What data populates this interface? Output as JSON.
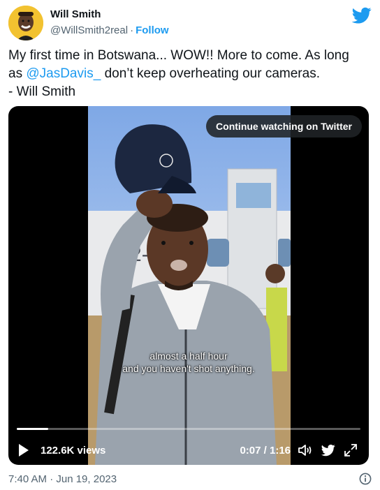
{
  "author": {
    "name": "Will Smith",
    "handle": "@WillSmith2real",
    "separator": "·",
    "follow_label": "Follow"
  },
  "tweet": {
    "line1": "My first time in Botswana... WOW!! More to come. As long",
    "line2_prefix": "as ",
    "mention": "@JasDavis_",
    "line2_suffix": " don’t keep overheating our cameras.",
    "line3": "- Will Smith"
  },
  "video": {
    "continue_label": "Continue watching on Twitter",
    "caption_line1": "almost a half hour",
    "caption_line2": "and you haven't shot anything.",
    "views": "122.6K views",
    "time": "0:07 / 1:16",
    "progress": 0.092
  },
  "footer": {
    "timestamp": "7:40 AM · Jun 19, 2023"
  },
  "icons": {
    "brand": "twitter-bird-icon",
    "play": "play-icon",
    "volume": "volume-icon",
    "expand": "expand-icon",
    "info": "info-icon"
  },
  "colors": {
    "accent": "#1d9bf0",
    "text": "#0f1419",
    "muted": "#536471",
    "video_bg": "#000000"
  }
}
